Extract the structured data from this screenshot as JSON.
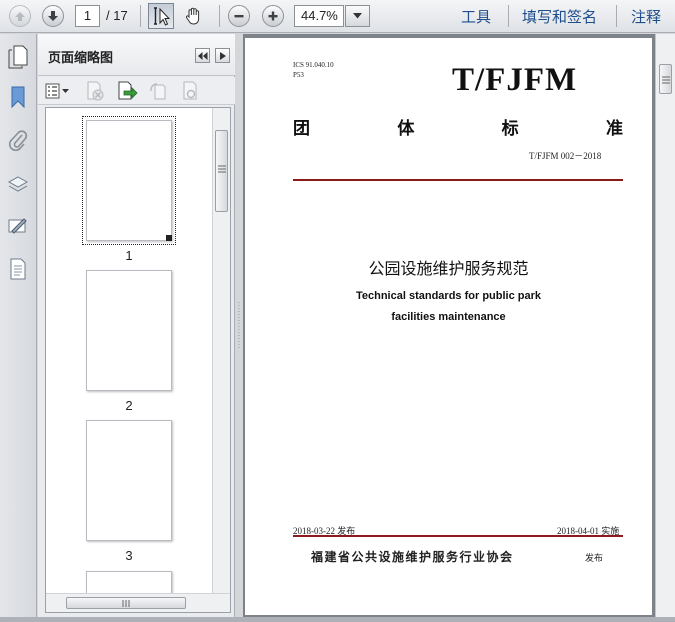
{
  "toolbar": {
    "page_current": "1",
    "page_total": "/ 17",
    "zoom": "44.7%",
    "tools_label": "工具",
    "sign_label": "填写和签名",
    "comment_label": "注释"
  },
  "thumbnail_panel": {
    "title": "页面缩略图",
    "thumbnails": [
      {
        "label": "1"
      },
      {
        "label": "2"
      },
      {
        "label": "3"
      }
    ]
  },
  "document": {
    "ics": "ICS 91.040.10",
    "ccs": "P53",
    "standard_logo": "T/FJFM",
    "standard_type_chars": [
      "团",
      "体",
      "标",
      "准"
    ],
    "standard_code": "T/FJFM 002－2018",
    "title_cn": "公园设施维护服务规范",
    "title_en_line1": "Technical standards for public park",
    "title_en_line2": "facilities maintenance",
    "publish_date": "2018-03-22 发布",
    "implement_date": "2018-04-01 实施",
    "issuer": "福建省公共设施维护服务行业协会",
    "issuer_suffix": "发布"
  },
  "colors": {
    "link_blue": "#1f4e8c",
    "rule_red": "#8b1a1a",
    "doc_background": "#7e8389"
  }
}
